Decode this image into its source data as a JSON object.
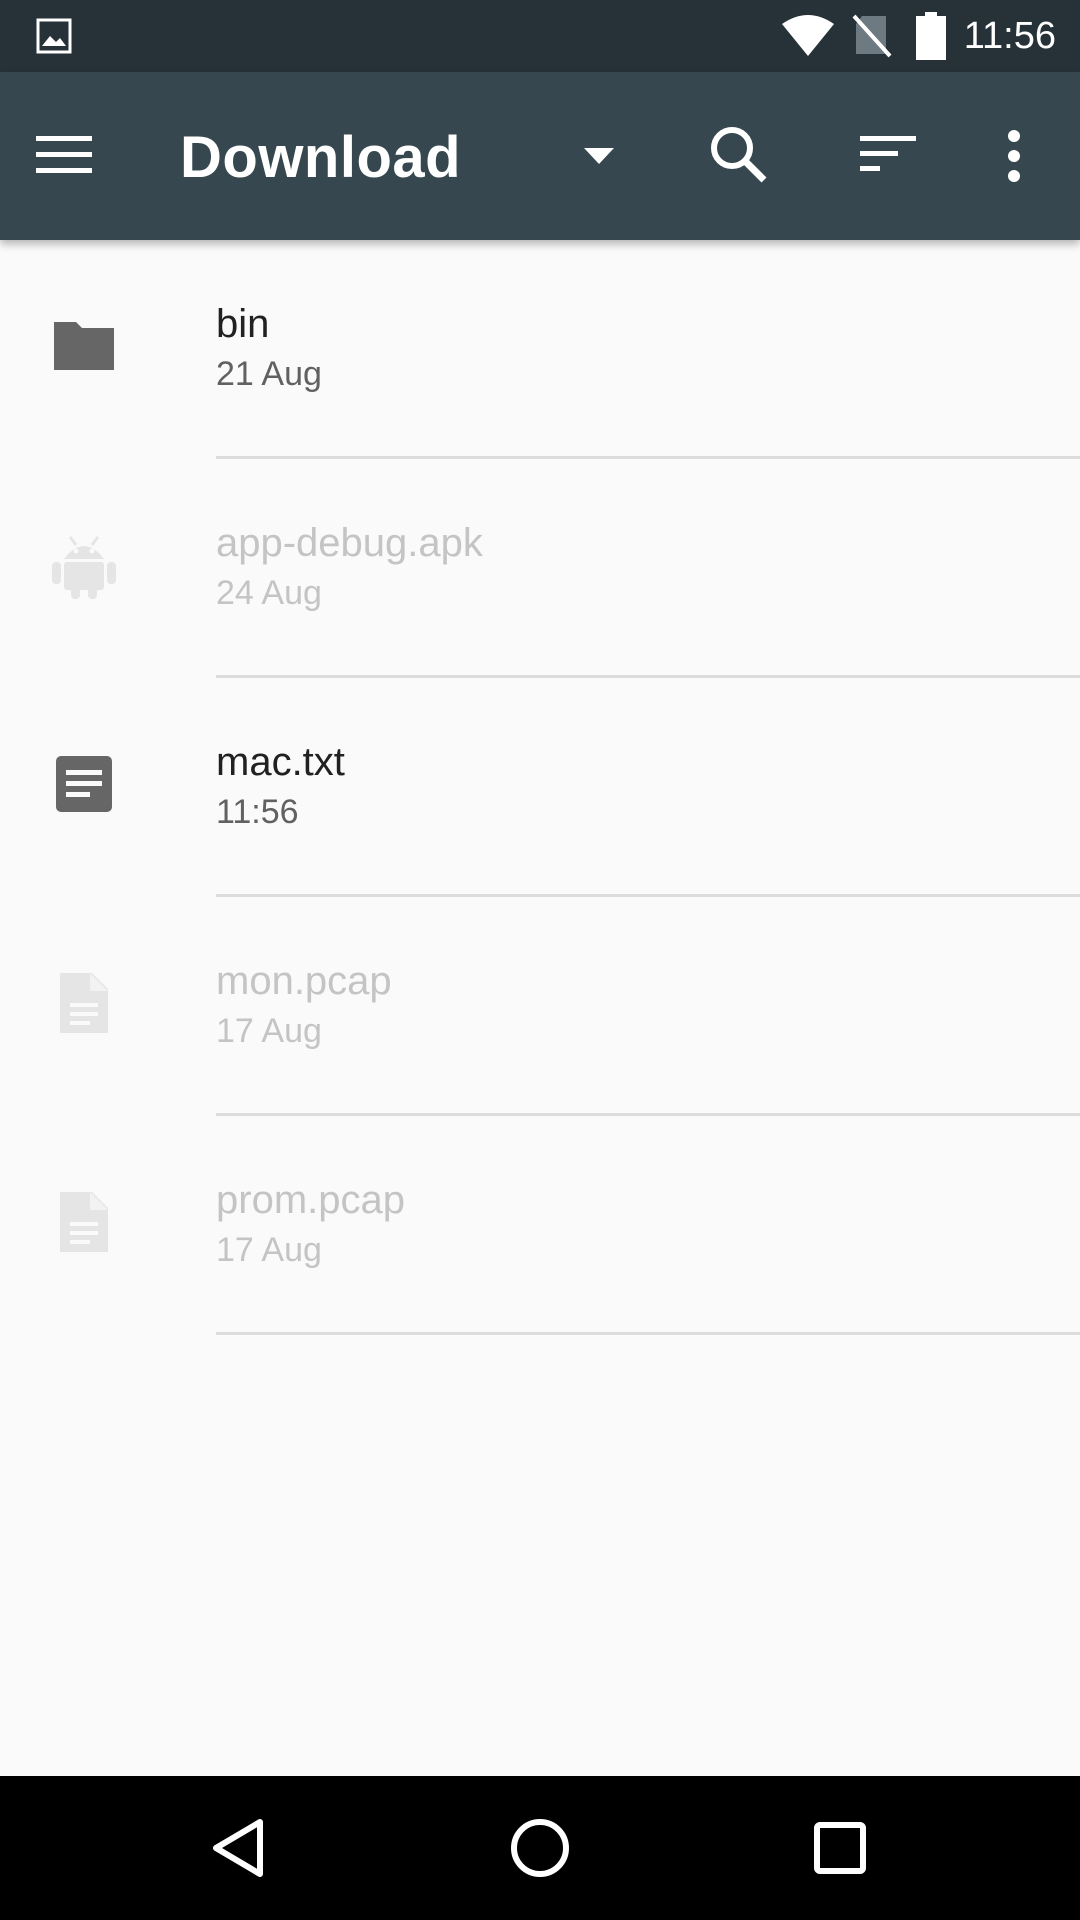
{
  "status_bar": {
    "time": "11:56",
    "icons": [
      "image-notification-icon",
      "wifi-icon",
      "no-sim-icon",
      "battery-icon"
    ]
  },
  "toolbar": {
    "title": "Download",
    "icons": [
      "menu-icon",
      "dropdown-arrow-icon",
      "search-icon",
      "sort-icon",
      "more-vert-icon"
    ],
    "color": "#37474f"
  },
  "files": [
    {
      "name": "bin",
      "date": "21 Aug",
      "icon": "folder-icon",
      "enabled": true
    },
    {
      "name": "app-debug.apk",
      "date": "24 Aug",
      "icon": "android-icon",
      "enabled": false
    },
    {
      "name": "mac.txt",
      "date": "11:56",
      "icon": "text-document-icon",
      "enabled": true
    },
    {
      "name": "mon.pcap",
      "date": "17 Aug",
      "icon": "file-icon",
      "enabled": false
    },
    {
      "name": "prom.pcap",
      "date": "17 Aug",
      "icon": "file-icon",
      "enabled": false
    }
  ],
  "nav_bar": {
    "icons": [
      "back-icon",
      "home-icon",
      "recents-icon"
    ]
  }
}
